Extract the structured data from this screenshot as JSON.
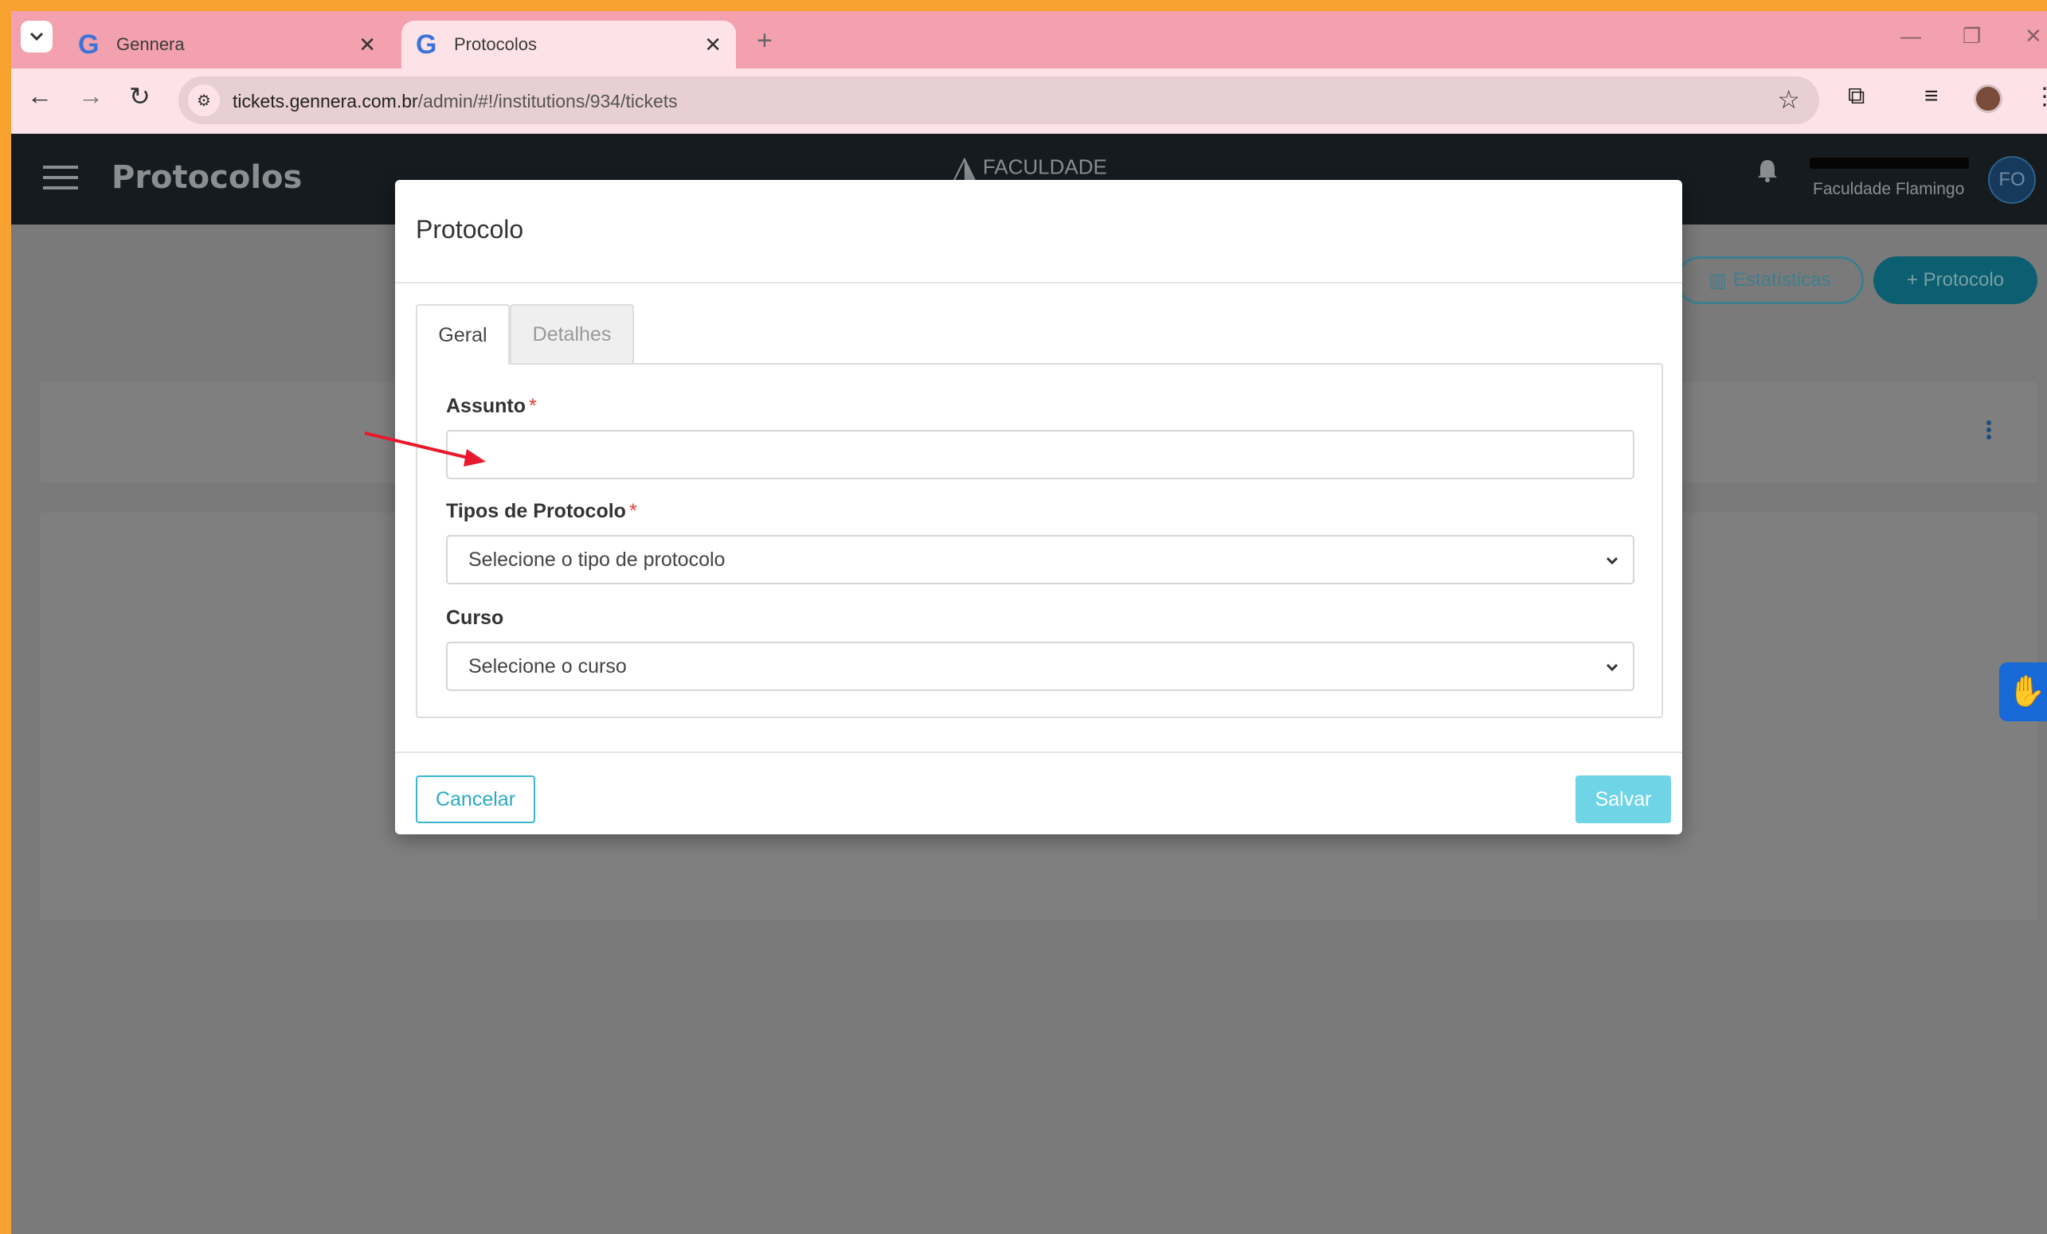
{
  "browser": {
    "tabs": [
      {
        "title": "Gennera",
        "active": false
      },
      {
        "title": "Protocolos",
        "active": true
      }
    ],
    "url_host": "tickets.gennera.com.br",
    "url_path": "/admin/#!/institutions/934/tickets"
  },
  "header": {
    "title": "Protocolos",
    "brand_text": "FACULDADE",
    "institution": "Faculdade Flamingo",
    "avatar_initials": "FO"
  },
  "page": {
    "stats_label": "Estatísticas",
    "new_label": "+ Protocolo"
  },
  "modal": {
    "title": "Protocolo",
    "tabs": [
      {
        "label": "Geral",
        "active": true
      },
      {
        "label": "Detalhes",
        "active": false
      }
    ],
    "fields": {
      "subject": {
        "label": "Assunto",
        "required_mark": "*",
        "value": ""
      },
      "type": {
        "label": "Tipos de Protocolo",
        "required_mark": "*",
        "selected": "Selecione o tipo de protocolo"
      },
      "course": {
        "label": "Curso",
        "selected": "Selecione o curso"
      }
    },
    "cancel_label": "Cancelar",
    "save_label": "Salvar"
  },
  "colors": {
    "accent": "#2aa9c6",
    "save_disabled": "#6fd4e6",
    "required": "#e53935",
    "annotation_arrow": "#e8192c"
  }
}
